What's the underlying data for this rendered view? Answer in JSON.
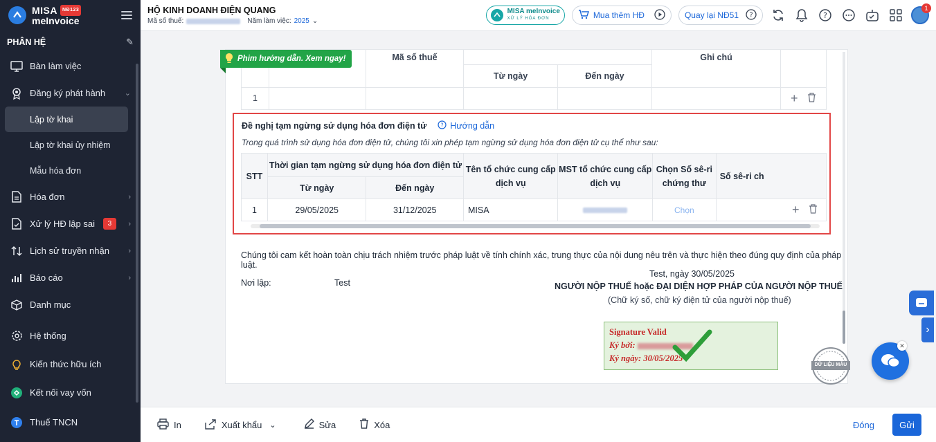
{
  "brand": {
    "line1": "MISA",
    "badge": "NĐ123",
    "line2": "meInvoice"
  },
  "sidebar": {
    "module_title": "PHÂN HỆ",
    "items": [
      {
        "label": "Bàn làm việc",
        "icon": "monitor-icon"
      },
      {
        "label": "Đăng ký phát hành",
        "icon": "badge-icon",
        "expanded": true,
        "children": [
          {
            "label": "Lập tờ khai",
            "active": true
          },
          {
            "label": "Lập tờ khai ủy nhiệm"
          },
          {
            "label": "Mẫu hóa đơn"
          }
        ]
      },
      {
        "label": "Hóa đơn",
        "icon": "document-icon"
      },
      {
        "label": "Xử lý HĐ lập sai",
        "icon": "document-check-icon",
        "badge": "3"
      },
      {
        "label": "Lịch sử truyền nhận",
        "icon": "transfer-icon"
      },
      {
        "label": "Báo cáo",
        "icon": "bar-chart-icon"
      },
      {
        "label": "Danh mục",
        "icon": "box-icon"
      },
      {
        "label": "Hệ thống",
        "icon": "gear-icon"
      },
      {
        "label": "Kiến thức hữu ích",
        "icon": "lightbulb-icon"
      },
      {
        "label": "Kết nối vay vốn",
        "icon": "link-icon"
      },
      {
        "label": "Thuế TNCN",
        "icon": "tax-icon"
      }
    ]
  },
  "header": {
    "company_name": "HỘ KINH DOANH ĐIỆN QUANG",
    "tax_code_label": "Mã số thuế:",
    "year_label": "Năm làm việc:",
    "year_value": "2025",
    "misa_pill_line1": "MISA meInvoice",
    "misa_pill_line2": "XỬ LÝ HÓA ĐƠN",
    "buy_more": "Mua thêm HĐ",
    "back_nd51": "Quay lại NĐ51",
    "notification_count": "1"
  },
  "top_table": {
    "tax_code_header": "Mã số thuế",
    "from_header": "Từ ngày",
    "to_header": "Đến ngày",
    "note_header": "Ghi chú",
    "row_index": "1"
  },
  "guide_tag": "Phim hướng dẫn. Xem ngay!",
  "suspension": {
    "title": "Đề nghị tạm ngừng sử dụng hóa đơn điện tử",
    "guide_link": "Hướng dẫn",
    "description": "Trong quá trình sử dụng hóa đơn điện tử, chúng tôi xin phép tạm ngừng sử dụng hóa đơn điện tử cụ thể như sau:",
    "headers": {
      "stt": "STT",
      "period": "Thời gian tạm ngừng sử dụng hóa đơn điện tử",
      "from": "Từ ngày",
      "to": "Đến ngày",
      "provider_name": "Tên tổ chức cung cấp dịch vụ",
      "provider_tax": "MST tổ chức cung cấp dịch vụ",
      "serial_choose": "Chọn Số sê-ri chứng thư",
      "serial": "Số sê-ri ch"
    },
    "rows": [
      {
        "stt": "1",
        "from": "29/05/2025",
        "to": "31/12/2025",
        "provider_name": "MISA",
        "choose": "Chọn"
      }
    ]
  },
  "commitment": "Chúng tôi cam kết hoàn toàn chịu trách nhiệm trước pháp luật về tính chính xác, trung thực của nội dung nêu trên và thực hiện theo đúng quy định của pháp luật.",
  "place": {
    "label": "Nơi lập:",
    "value": "Test"
  },
  "signature_block": {
    "date_line": "Test, ngày 30/05/2025",
    "title": "NGƯỜI NỘP THUẾ hoặc ĐẠI DIỆN HỢP PHÁP CỦA NGƯỜI NỘP THUẾ",
    "note": "(Chữ ký số, chữ ký điện tử của người nộp thuế)",
    "valid": "Signature Valid",
    "signed_by_label": "Ký bởi:",
    "signed_date_label": "Ký ngày:",
    "signed_date": "30/05/2025"
  },
  "stamp_text": "DỮ LIỆU MẪU",
  "footer": {
    "print": "In",
    "export": "Xuất khẩu",
    "edit": "Sửa",
    "delete": "Xóa",
    "close": "Đóng",
    "send": "Gửi"
  },
  "colors": {
    "primary": "#1a66d9",
    "sidebar_bg": "#1e2433",
    "danger": "#e53935",
    "success": "#22a447"
  }
}
